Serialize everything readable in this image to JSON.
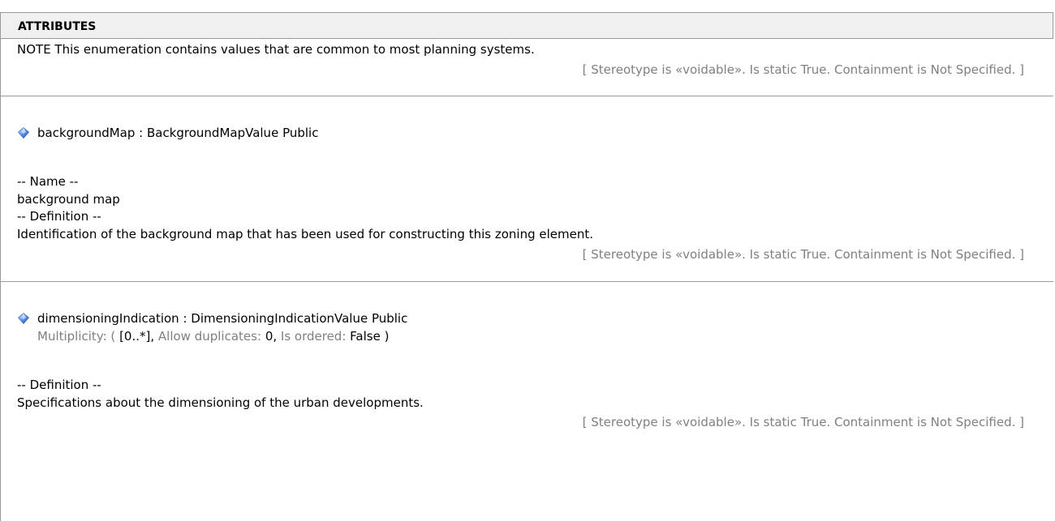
{
  "section_title": "ATTRIBUTES",
  "note": "NOTE This enumeration contains values that are common to most planning systems.",
  "note_meta": "[ Stereotype is «voidable». Is static True. Containment is Not Specified. ]",
  "attributes": [
    {
      "icon": "attribute-diamond-icon",
      "signature": "backgroundMap : BackgroundMapValue  Public",
      "name_header": "-- Name --",
      "name_value": "background map",
      "definition_header": "-- Definition --",
      "definition_value": "Identification of the background map that has been used for constructing this zoning element.",
      "meta": "[ Stereotype is «voidable». Is static True. Containment is Not Specified. ]"
    },
    {
      "icon": "attribute-diamond-icon",
      "signature": "dimensioningIndication : DimensioningIndicationValue  Public",
      "multiplicity_label": "Multiplicity: (",
      "multiplicity_value": "[0..*],",
      "duplicates_label": "Allow duplicates:",
      "duplicates_value": "0,",
      "ordered_label": "Is ordered:",
      "ordered_value": "False )",
      "definition_header": "-- Definition --",
      "definition_value": "Specifications about the dimensioning of the urban developments.",
      "meta": "[ Stereotype is «voidable». Is static True. Containment is Not Specified. ]"
    }
  ],
  "colors": {
    "header_bg": "#f0f0f0",
    "border": "#9a9a9a",
    "meta_text": "#808080",
    "icon_blue": "#3b6fd0"
  }
}
